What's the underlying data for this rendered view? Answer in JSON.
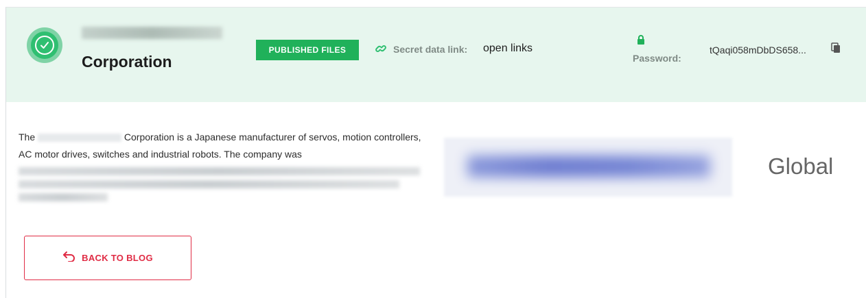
{
  "header": {
    "company_name_blurred": "",
    "title": "Corporation",
    "status_badge": "PUBLISHED FILES",
    "secret_link_label": "Secret data link:",
    "secret_link_value": "open links",
    "password_label": "Password:",
    "password_value": "tQaqi058mDbDS658..."
  },
  "content": {
    "description_lead": "The",
    "description_rest": "Corporation is a Japanese manufacturer of servos, motion controllers, AC motor drives, switches and industrial robots. The company was",
    "region_label": "Global",
    "back_button_label": "BACK TO BLOG"
  },
  "colors": {
    "header_bg": "#e7f6ee",
    "accent_green": "#20b15a",
    "accent_red": "#e02b44"
  },
  "icons": [
    "check-circle-icon",
    "link-icon",
    "lock-icon",
    "copy-icon",
    "back-arrow-icon"
  ]
}
